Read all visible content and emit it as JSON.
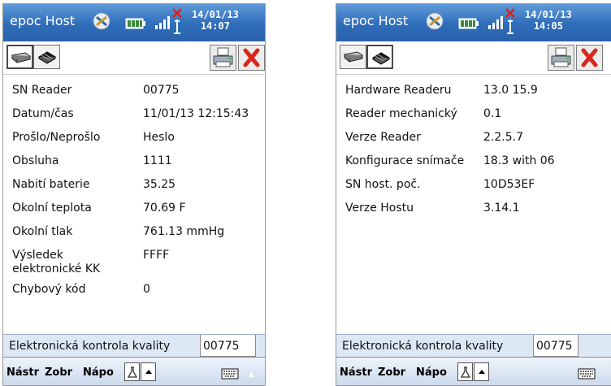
{
  "screens": [
    {
      "title": "epoc Host",
      "clock": {
        "date": "14/01/13",
        "time": "14:07"
      },
      "active_tab": 0,
      "rows": [
        {
          "label": "SN Reader",
          "value": "00775"
        },
        {
          "label": "Datum/čas",
          "value": "11/01/13 12:15:43"
        },
        {
          "label": "Prošlo/Neprošlo",
          "value": "Heslo"
        },
        {
          "label": "Obsluha",
          "value": "1111"
        },
        {
          "label": "Nabití baterie",
          "value": "35.25"
        },
        {
          "label": "Okolní teplota",
          "value": "70.69 F"
        },
        {
          "label": "Okolní tlak",
          "value": "761.13 mmHg"
        },
        {
          "label": "Výsledek elektronické KK",
          "value": "FFFF"
        },
        {
          "label": "Chybový kód",
          "value": "0"
        }
      ],
      "bottom_tabs": [
        "Elektronická kontrola kvality",
        "00775"
      ],
      "menu": [
        "Nástr",
        "Zobr",
        "Nápo"
      ]
    },
    {
      "title": "epoc Host",
      "clock": {
        "date": "14/01/13",
        "time": "14:05"
      },
      "active_tab": 1,
      "rows": [
        {
          "label": "Hardware Readeru",
          "value": "13.0 15.9"
        },
        {
          "label": "Reader mechanický",
          "value": "0.1"
        },
        {
          "label": "Verze Reader",
          "value": "2.2.5.7"
        },
        {
          "label": "Konfigurace snímače",
          "value": "18.3 with 06"
        },
        {
          "label": "SN host. poč.",
          "value": "10D53EF"
        },
        {
          "label": "Verze Hostu",
          "value": "3.14.1"
        }
      ],
      "bottom_tabs": [
        "Elektronická kontrola kvality",
        "00775"
      ],
      "menu": [
        "Nástr",
        "Zobr",
        "Nápo"
      ]
    }
  ],
  "icons": {
    "sync": "sync-icon",
    "battery": "battery-icon",
    "signal": "signal-strength-icon",
    "antenna": "antenna-off-icon",
    "reader_tab": "reader-device-icon",
    "chip_tab": "chip-icon",
    "print": "printer-icon",
    "close": "close-icon",
    "keyboard": "keyboard-icon"
  },
  "colors": {
    "titlebar": "#2f6cb9",
    "tab_strip": "#dde8f5",
    "close_red": "#d8281e"
  }
}
